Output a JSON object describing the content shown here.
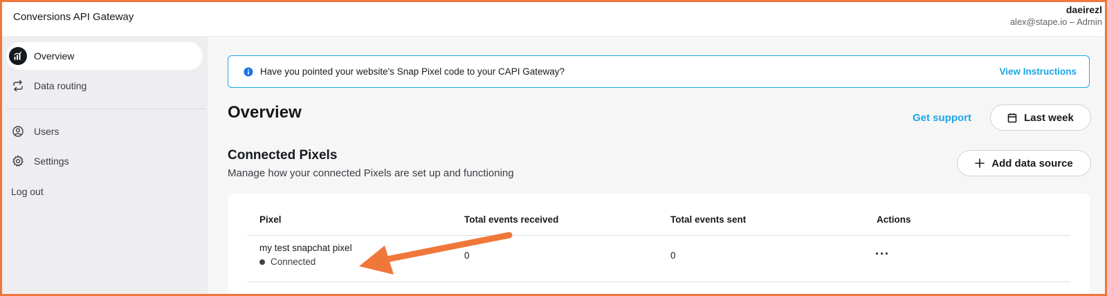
{
  "header": {
    "app_title": "Conversions API Gateway",
    "user_name": "daeirezl",
    "user_role": "alex@stape.io – Admin"
  },
  "sidebar": {
    "items": [
      {
        "label": "Overview",
        "icon": "chart-bars-icon",
        "active": true
      },
      {
        "label": "Data routing",
        "icon": "swap-arrows-icon",
        "active": false
      },
      {
        "label": "Users",
        "icon": "user-circle-icon",
        "active": false
      },
      {
        "label": "Settings",
        "icon": "gear-icon",
        "active": false
      }
    ],
    "logout_label": "Log out"
  },
  "banner": {
    "icon": "info-icon",
    "text": "Have you pointed your website's Snap Pixel code to your CAPI Gateway?",
    "link_label": "View Instructions"
  },
  "main": {
    "title": "Overview",
    "support_label": "Get support",
    "date_range_label": "Last week",
    "section_title": "Connected Pixels",
    "section_subtitle": "Manage how your connected Pixels are set up and functioning",
    "add_source_label": "Add data source"
  },
  "table": {
    "columns": [
      "Pixel",
      "Total events received",
      "Total events sent",
      "Actions"
    ],
    "rows": [
      {
        "pixel_name": "my test snapchat pixel",
        "status": "Connected",
        "received": "0",
        "sent": "0",
        "actions": "···"
      }
    ]
  },
  "colors": {
    "accent": "#1aa7e8",
    "frame": "#f0773a",
    "annotation_arrow": "#f0773a"
  }
}
